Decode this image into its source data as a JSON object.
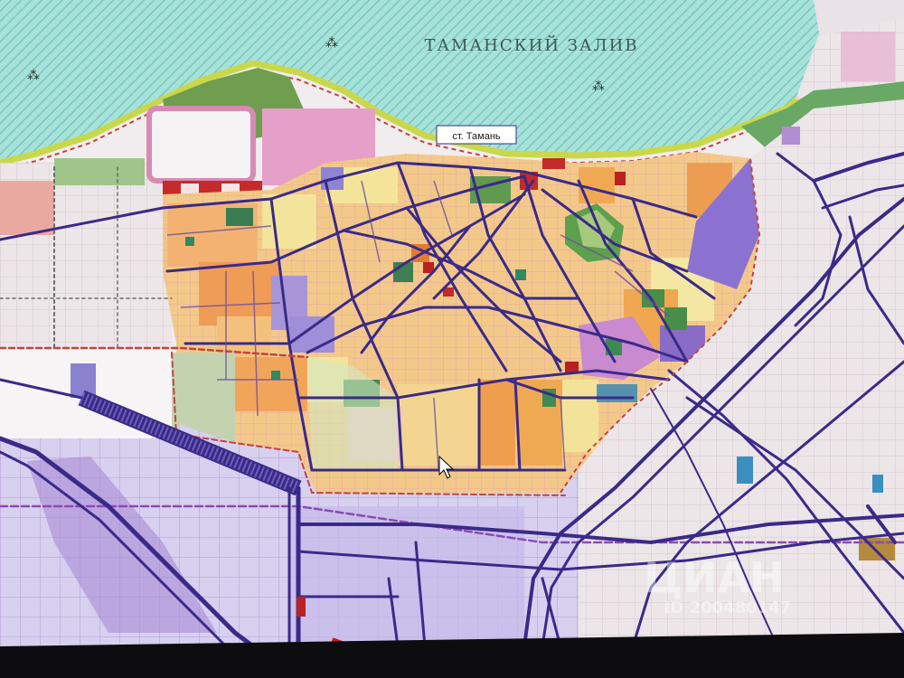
{
  "map": {
    "bay_label": "ТАМАНСКИЙ ЗАЛИВ",
    "settlement_label": "ст. Тамань",
    "watermark_brand": "ЦИАН",
    "watermark_id": "ID 200480147"
  },
  "colors": {
    "sea": "#9fded6",
    "sea_hatch": "#7cc7bd",
    "residential": "#f2b06c",
    "residential_light": "#f3d28c",
    "park": "#4f9a5c",
    "industrial": "#c6c0e8",
    "pink_zone": "#e08fbf",
    "purple_zone": "#7e5fc9",
    "road": "#3b2a86",
    "shore": "#c9d84a",
    "gray_zone": "#e7e2e6"
  }
}
